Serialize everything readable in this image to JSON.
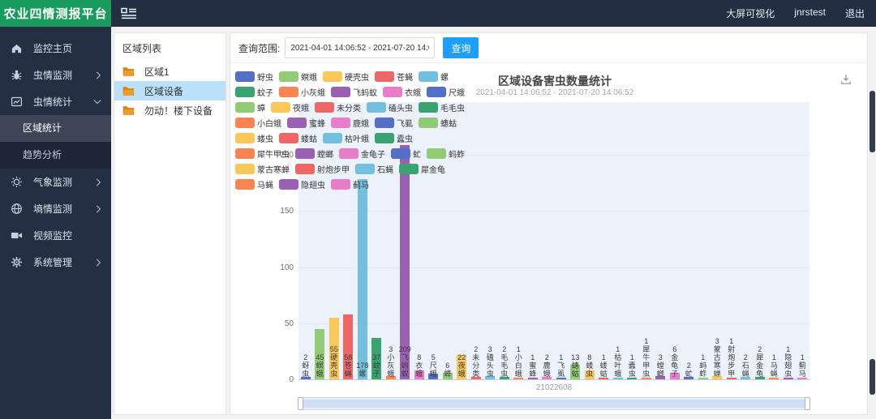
{
  "header": {
    "logo": "农业四情测报平台",
    "links": [
      "大屏可视化",
      "jnrstest",
      "退出"
    ]
  },
  "sidebar": {
    "items": [
      {
        "label": "监控主页",
        "icon": "home-icon",
        "chevron": null
      },
      {
        "label": "虫情监测",
        "icon": "bug-icon",
        "chevron": "right"
      },
      {
        "label": "虫情统计",
        "icon": "chart-icon",
        "chevron": "down",
        "children": [
          {
            "label": "区域统计",
            "active": true
          },
          {
            "label": "趋势分析",
            "active": false
          }
        ]
      },
      {
        "label": "气象监测",
        "icon": "weather-icon",
        "chevron": "right"
      },
      {
        "label": "墒情监测",
        "icon": "soil-icon",
        "chevron": "right"
      },
      {
        "label": "视频监控",
        "icon": "video-icon",
        "chevron": null
      },
      {
        "label": "系统管理",
        "icon": "settings-icon",
        "chevron": "right"
      }
    ]
  },
  "region_panel": {
    "title": "区域列表",
    "items": [
      {
        "label": "区域1",
        "selected": false
      },
      {
        "label": "区域设备",
        "selected": true
      },
      {
        "label": "勿动！楼下设备",
        "selected": false
      }
    ]
  },
  "query": {
    "label": "查询范围:",
    "range": "2021-04-01 14:06:52 - 2021-07-20 14:06:52",
    "button_label": "查询"
  },
  "chart_data": {
    "type": "bar",
    "title": "区域设备害虫数量统计",
    "subtitle": "2021-04-01 14:06:52 - 2021-07-20 14:06:52",
    "categories": [
      "蚜虫",
      "螟蛾",
      "硬壳虫",
      "苍蝇",
      "螺",
      "蚊子",
      "小灰蛾",
      "飞蚂蚁",
      "衣蛾",
      "尺蛾",
      "蟑",
      "夜蛾",
      "未分类",
      "磕头虫",
      "毛毛虫",
      "小白蛾",
      "蜜蜂",
      "鹿蛾",
      "飞虱",
      "蟪蛄",
      "蝼虫",
      "蝼蛄",
      "枯叶蛾",
      "蠹虫",
      "犀牛甲虫",
      "螳螂",
      "金龟子",
      "虻",
      "蚂蚱",
      "蒙古寒蝉",
      "射炮步甲",
      "石蝇",
      "犀金龟",
      "马蝇",
      "隐翅虫",
      "蓟马"
    ],
    "values": [
      2,
      45,
      55,
      58,
      178,
      37,
      3,
      209,
      8,
      5,
      6,
      22,
      2,
      3,
      2,
      1,
      1,
      2,
      1,
      13,
      8,
      1,
      1,
      1,
      1,
      3,
      6,
      2,
      1,
      3,
      1,
      2,
      2,
      1,
      1,
      1
    ],
    "palette": [
      "#5470c6",
      "#91cc75",
      "#fac858",
      "#ee6666",
      "#73c0de",
      "#3ba272",
      "#fc8452",
      "#9a60b4",
      "#ea7ccc"
    ],
    "ylim": [
      0,
      200
    ],
    "yticks": [
      0,
      50,
      100,
      150,
      200
    ],
    "xlabel": "21022608",
    "legend_position": "top-left",
    "grid": true,
    "plot_bg_color": "#ebf2fc"
  }
}
